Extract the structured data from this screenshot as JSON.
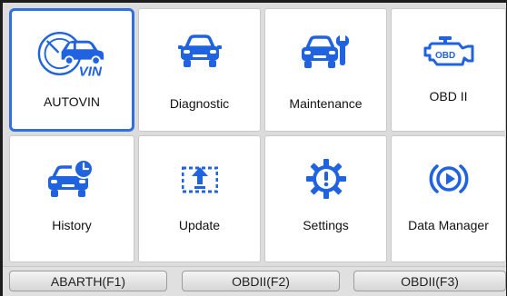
{
  "tiles": [
    {
      "label": "AUTOVIN",
      "icon": "autovin-car-icon",
      "vin_text": "VIN"
    },
    {
      "label": "Diagnostic",
      "icon": "car-front-icon"
    },
    {
      "label": "Maintenance",
      "icon": "car-wrench-icon"
    },
    {
      "label": "OBD II",
      "icon": "engine-obd-icon",
      "obd_text": "OBD"
    },
    {
      "label": "History",
      "icon": "car-clock-icon"
    },
    {
      "label": "Update",
      "icon": "update-upload-icon"
    },
    {
      "label": "Settings",
      "icon": "gear-warning-icon"
    },
    {
      "label": "Data Manager",
      "icon": "play-circle-icon"
    }
  ],
  "function_keys": [
    {
      "label": "ABARTH(F1)"
    },
    {
      "label": "OBDII(F2)"
    },
    {
      "label": "OBDII(F3)"
    }
  ],
  "colors": {
    "accent": "#2f6fe0",
    "icon_blue": "#1f63e0",
    "tile_bg": "#ffffff",
    "grid_bg": "#dcdcdc"
  }
}
